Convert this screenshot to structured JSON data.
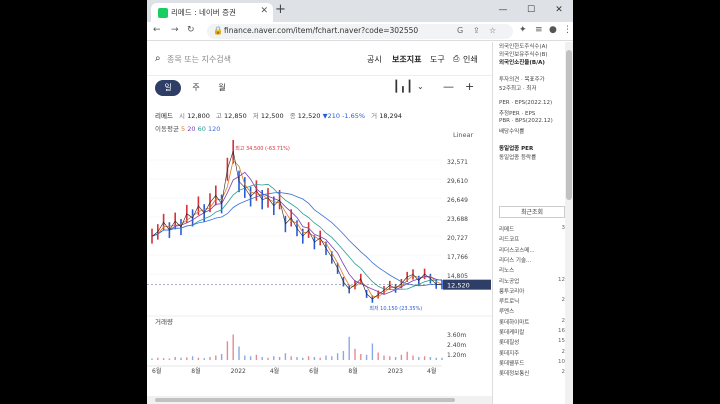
{
  "browser": {
    "tab_title": "리메드 : 네이버 증권",
    "url": "finance.naver.com/item/fchart.naver?code=302550"
  },
  "toolbar": {
    "search_placeholder": "종목 또는 지수검색",
    "menu": [
      "공시",
      "보조지표",
      "도구",
      "인쇄"
    ]
  },
  "periods": {
    "items": [
      "일",
      "주",
      "월"
    ],
    "active": "일"
  },
  "quote": {
    "name": "리메드",
    "open_label": "시",
    "open": "12,800",
    "high_label": "고",
    "high": "12,850",
    "low_label": "저",
    "low": "12,500",
    "close_label": "종",
    "close": "12,520",
    "change": "▼210",
    "change_pct": "-1.65%",
    "volume_label": "거",
    "volume": "18,294"
  },
  "moving_avg": {
    "label": "이동평균",
    "p5": "5",
    "p20": "20",
    "p60": "60",
    "p120": "120"
  },
  "scale_mode": "Linear",
  "chart_data": {
    "type": "line",
    "title": "",
    "price_ticks": [
      "32,571",
      "29,610",
      "26,649",
      "23,688",
      "20,727",
      "17,766",
      "14,805"
    ],
    "current_price_label": "12,520",
    "max_annotation": "최고 34,500 (-63.71%)",
    "min_annotation": "최저 10,150 (23.35%)",
    "volume_label": "거래량",
    "volume_ticks": [
      "3.60m",
      "2.40m",
      "1.20m"
    ],
    "x_ticks": [
      "6월",
      "8월",
      "2022",
      "4월",
      "6월",
      "8월",
      "2023",
      "4월"
    ],
    "ylim": [
      10000,
      35000
    ],
    "series": [
      {
        "x": [
          0,
          6,
          12,
          18,
          24,
          30,
          36,
          42,
          48,
          54,
          60,
          66,
          72,
          78,
          84,
          90,
          96,
          102,
          108,
          114,
          120,
          126,
          132,
          138,
          144,
          150,
          156,
          162,
          168,
          174,
          180,
          186,
          192,
          198,
          204,
          210,
          216,
          222,
          228,
          234,
          240,
          246,
          252,
          258,
          264,
          270,
          276,
          282,
          288,
          294,
          300
        ],
        "values": [
          20500,
          21200,
          22800,
          21500,
          23000,
          22000,
          24200,
          23500,
          25500,
          24300,
          26000,
          27200,
          25800,
          31500,
          34500,
          29500,
          28500,
          27000,
          28000,
          26500,
          26800,
          25500,
          26500,
          22500,
          23500,
          21800,
          20500,
          21500,
          19500,
          20200,
          18500,
          17000,
          15200,
          13000,
          11800,
          12500,
          13500,
          11000,
          10150,
          10900,
          11600,
          12400,
          11900,
          12700,
          13800,
          14200,
          13200,
          14300,
          13500,
          12600,
          12520
        ]
      }
    ],
    "volume": [
      0.2,
      0.3,
      0.25,
      0.2,
      0.4,
      0.3,
      0.35,
      0.5,
      0.3,
      0.25,
      0.4,
      0.6,
      0.8,
      2.5,
      3.4,
      1.8,
      0.6,
      0.5,
      0.7,
      0.4,
      0.3,
      0.5,
      0.4,
      0.9,
      0.5,
      0.4,
      0.3,
      0.5,
      0.4,
      0.3,
      0.6,
      0.5,
      0.9,
      1.2,
      3.1,
      1.5,
      0.8,
      0.7,
      2.2,
      1.0,
      0.6,
      0.5,
      0.4,
      0.7,
      1.1,
      0.6,
      0.4,
      0.5,
      0.4,
      0.3,
      0.3
    ]
  },
  "sidebar": {
    "top_items": [
      "외국인한도주식수(A)",
      "외국인보유주식수(B)",
      "외국인소진율(B/A)"
    ],
    "mid_items": [
      "투자의견 · 목표주가",
      "52주최고 · 최저"
    ],
    "per_items": [
      "PER · EPS(2022.12)",
      "추정PER · EPS",
      "PBR · BPS(2022.12)",
      "배당수익률"
    ],
    "industry_items": [
      "동일업종 PER",
      "동일업종 등락률"
    ],
    "recent_header": "최근조회",
    "recent": [
      {
        "name": "리메드",
        "n": "3"
      },
      {
        "name": "리드코프",
        "n": ""
      },
      {
        "name": "리더스코스메...",
        "n": ""
      },
      {
        "name": "리더스 기술...",
        "n": ""
      },
      {
        "name": "리노스",
        "n": ""
      },
      {
        "name": "리노공업",
        "n": "12"
      },
      {
        "name": "룽투코리아",
        "n": ""
      },
      {
        "name": "루트로닉",
        "n": "2"
      },
      {
        "name": "루멘스",
        "n": ""
      },
      {
        "name": "롯데하이마트",
        "n": "2"
      },
      {
        "name": "롯데케미칼",
        "n": "16"
      },
      {
        "name": "롯데칠성",
        "n": "15"
      },
      {
        "name": "롯데지주",
        "n": "2"
      },
      {
        "name": "롯데웰푸드",
        "n": "10"
      },
      {
        "name": "롯데정보통신",
        "n": "2"
      }
    ]
  }
}
